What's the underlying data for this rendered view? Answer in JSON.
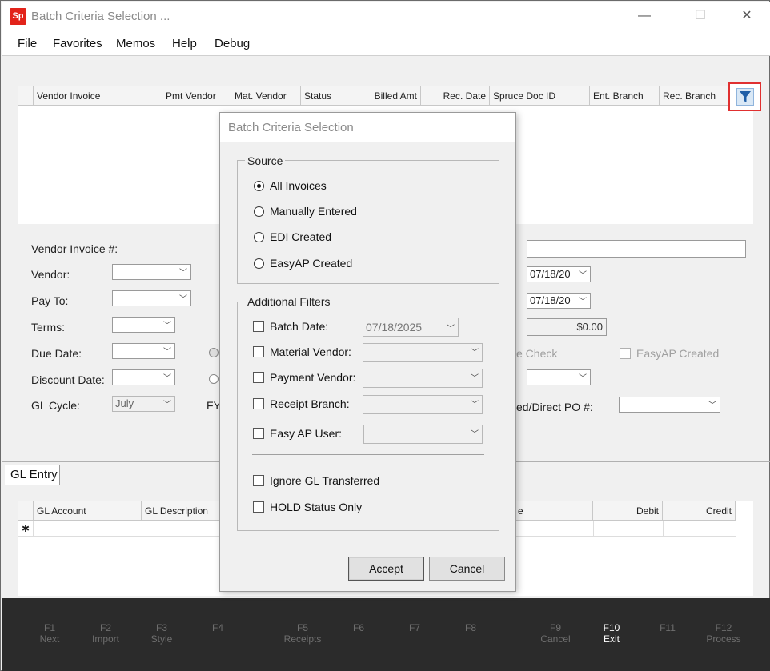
{
  "window": {
    "title": "Batch Criteria Selection ...",
    "icon_text": "Sp",
    "minimize": "—",
    "maximize": "☐",
    "close": "✕"
  },
  "menu": [
    "File",
    "Favorites",
    "Memos",
    "Help",
    "Debug"
  ],
  "grid1": {
    "columns": [
      "Vendor Invoice",
      "Pmt Vendor",
      "Mat. Vendor",
      "Status",
      "Billed Amt",
      "Rec. Date",
      "Spruce Doc ID",
      "Ent. Branch",
      "Rec. Branch"
    ]
  },
  "form": {
    "vendor_invoice_label": "Vendor Invoice #:",
    "vendor_label": "Vendor:",
    "pay_to_label": "Pay To:",
    "terms_label": "Terms:",
    "due_date_label": "Due Date:",
    "discount_date_label": "Discount Date:",
    "gl_cycle_label": "GL Cycle:",
    "gl_cycle_value": "July",
    "fy_label": "FY",
    "date1": "07/18/20",
    "date2": "07/18/20",
    "amount": "$0.00",
    "check_partial": "e Check",
    "easyap_created_label": "EasyAP Created",
    "po_label": "ed/Direct PO #:"
  },
  "gl": {
    "tab": "GL Entry",
    "columns": [
      "GL Account",
      "GL Description",
      "e",
      "Debit",
      "Credit"
    ],
    "new_row_marker": "✱"
  },
  "footer": [
    {
      "key": "F1",
      "label": "Next"
    },
    {
      "key": "F2",
      "label": "Import"
    },
    {
      "key": "F3",
      "label": "Style"
    },
    {
      "key": "F4",
      "label": ""
    },
    {
      "key": "F5",
      "label": "Receipts"
    },
    {
      "key": "F6",
      "label": ""
    },
    {
      "key": "F7",
      "label": ""
    },
    {
      "key": "F8",
      "label": ""
    },
    {
      "key": "F9",
      "label": "Cancel"
    },
    {
      "key": "F10",
      "label": "Exit"
    },
    {
      "key": "F11",
      "label": ""
    },
    {
      "key": "F12",
      "label": "Process"
    }
  ],
  "modal": {
    "title": "Batch Criteria Selection",
    "source_legend": "Source",
    "source_options": [
      "All Invoices",
      "Manually Entered",
      "EDI Created",
      "EasyAP Created"
    ],
    "source_selected": "All Invoices",
    "filters_legend": "Additional Filters",
    "batch_date_label": "Batch Date:",
    "batch_date_value": "07/18/2025",
    "material_vendor_label": "Material Vendor:",
    "payment_vendor_label": "Payment Vendor:",
    "receipt_branch_label": "Receipt Branch:",
    "easy_ap_user_label": "Easy AP User:",
    "ignore_gl_label": "Ignore GL Transferred",
    "hold_status_label": "HOLD Status Only",
    "accept": "Accept",
    "cancel": "Cancel"
  }
}
